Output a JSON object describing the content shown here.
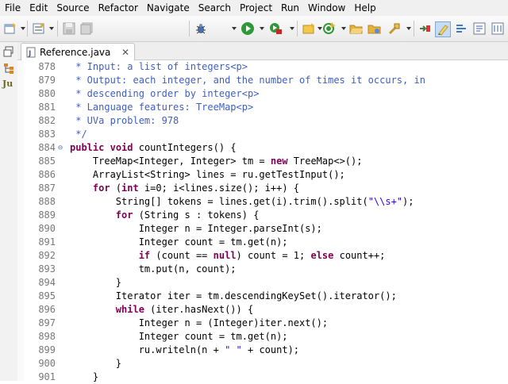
{
  "menu": [
    "File",
    "Edit",
    "Source",
    "Refactor",
    "Navigate",
    "Search",
    "Project",
    "Run",
    "Window",
    "Help"
  ],
  "toolbar": {
    "left_icons": [
      "new-wizard-icon",
      "new-item-icon",
      "save-icon",
      "save-all-icon"
    ],
    "right_icons": [
      "debug-icon",
      "run-icon",
      "external-tools-icon",
      "new-java-project-icon",
      "open-type-icon",
      "search-icon",
      "next-annotation-icon",
      "highlight-icon",
      "show-whitespace-icon",
      "toggle-comment-icon"
    ]
  },
  "editor_tab": {
    "title": "Reference.java",
    "close": "✕"
  },
  "left_panel": {
    "junit_label": "Ju"
  },
  "lines": [
    {
      "n": "878",
      "segs": [
        {
          "t": " * Input: a list of integers<p>",
          "c": "cj"
        }
      ]
    },
    {
      "n": "879",
      "segs": [
        {
          "t": " * Output: each integer, and the number of times it occurs, in",
          "c": "cj"
        }
      ]
    },
    {
      "n": "880",
      "segs": [
        {
          "t": " * descending order by integer<p>",
          "c": "cj"
        }
      ]
    },
    {
      "n": "881",
      "segs": [
        {
          "t": " * Language features: TreeMap<p>",
          "c": "cj"
        }
      ]
    },
    {
      "n": "882",
      "segs": [
        {
          "t": " * UVa problem: 978",
          "c": "cj"
        }
      ]
    },
    {
      "n": "883",
      "segs": [
        {
          "t": " */",
          "c": "cj"
        }
      ]
    },
    {
      "n": "884",
      "fold": "⊖",
      "segs": [
        {
          "t": "public",
          "c": "k"
        },
        {
          "t": " ",
          "c": "p"
        },
        {
          "t": "void",
          "c": "k"
        },
        {
          "t": " countIntegers() {",
          "c": "p"
        }
      ]
    },
    {
      "n": "885",
      "segs": [
        {
          "t": "    TreeMap<Integer, Integer> tm = ",
          "c": "p"
        },
        {
          "t": "new",
          "c": "k"
        },
        {
          "t": " TreeMap<>();",
          "c": "p"
        }
      ]
    },
    {
      "n": "886",
      "segs": [
        {
          "t": "    ArrayList<String> lines = ru.getTestInput();",
          "c": "p"
        }
      ]
    },
    {
      "n": "887",
      "segs": [
        {
          "t": "    ",
          "c": "p"
        },
        {
          "t": "for",
          "c": "k"
        },
        {
          "t": " (",
          "c": "p"
        },
        {
          "t": "int",
          "c": "k"
        },
        {
          "t": " i=0; i<lines.size(); i++) {",
          "c": "p"
        }
      ]
    },
    {
      "n": "888",
      "segs": [
        {
          "t": "        String[] tokens = lines.get(i).trim().split(",
          "c": "p"
        },
        {
          "t": "\"\\\\s+\"",
          "c": "s"
        },
        {
          "t": ");",
          "c": "p"
        }
      ]
    },
    {
      "n": "889",
      "segs": [
        {
          "t": "        ",
          "c": "p"
        },
        {
          "t": "for",
          "c": "k"
        },
        {
          "t": " (String s : tokens) {",
          "c": "p"
        }
      ]
    },
    {
      "n": "890",
      "segs": [
        {
          "t": "            Integer n = Integer.parseInt(s);",
          "c": "p"
        }
      ]
    },
    {
      "n": "891",
      "segs": [
        {
          "t": "            Integer count = tm.get(n);",
          "c": "p"
        }
      ]
    },
    {
      "n": "892",
      "segs": [
        {
          "t": "            ",
          "c": "p"
        },
        {
          "t": "if",
          "c": "k"
        },
        {
          "t": " (count == ",
          "c": "p"
        },
        {
          "t": "null",
          "c": "k"
        },
        {
          "t": ") count = 1; ",
          "c": "p"
        },
        {
          "t": "else",
          "c": "k"
        },
        {
          "t": " count++;",
          "c": "p"
        }
      ]
    },
    {
      "n": "893",
      "segs": [
        {
          "t": "            tm.put(n, count);",
          "c": "p"
        }
      ]
    },
    {
      "n": "894",
      "segs": [
        {
          "t": "        }",
          "c": "p"
        }
      ]
    },
    {
      "n": "895",
      "segs": [
        {
          "t": "        Iterator iter = tm.descendingKeySet().iterator();",
          "c": "p"
        }
      ]
    },
    {
      "n": "896",
      "segs": [
        {
          "t": "        ",
          "c": "p"
        },
        {
          "t": "while",
          "c": "k"
        },
        {
          "t": " (iter.hasNext()) {",
          "c": "p"
        }
      ]
    },
    {
      "n": "897",
      "segs": [
        {
          "t": "            Integer n = (Integer)iter.next();",
          "c": "p"
        }
      ]
    },
    {
      "n": "898",
      "segs": [
        {
          "t": "            Integer count = tm.get(n);",
          "c": "p"
        }
      ]
    },
    {
      "n": "899",
      "segs": [
        {
          "t": "            ru.writeln(n + ",
          "c": "p"
        },
        {
          "t": "\" \"",
          "c": "s"
        },
        {
          "t": " + count);",
          "c": "p"
        }
      ]
    },
    {
      "n": "900",
      "segs": [
        {
          "t": "        }",
          "c": "p"
        }
      ]
    },
    {
      "n": "901",
      "segs": [
        {
          "t": "    }",
          "c": "p"
        }
      ]
    }
  ]
}
